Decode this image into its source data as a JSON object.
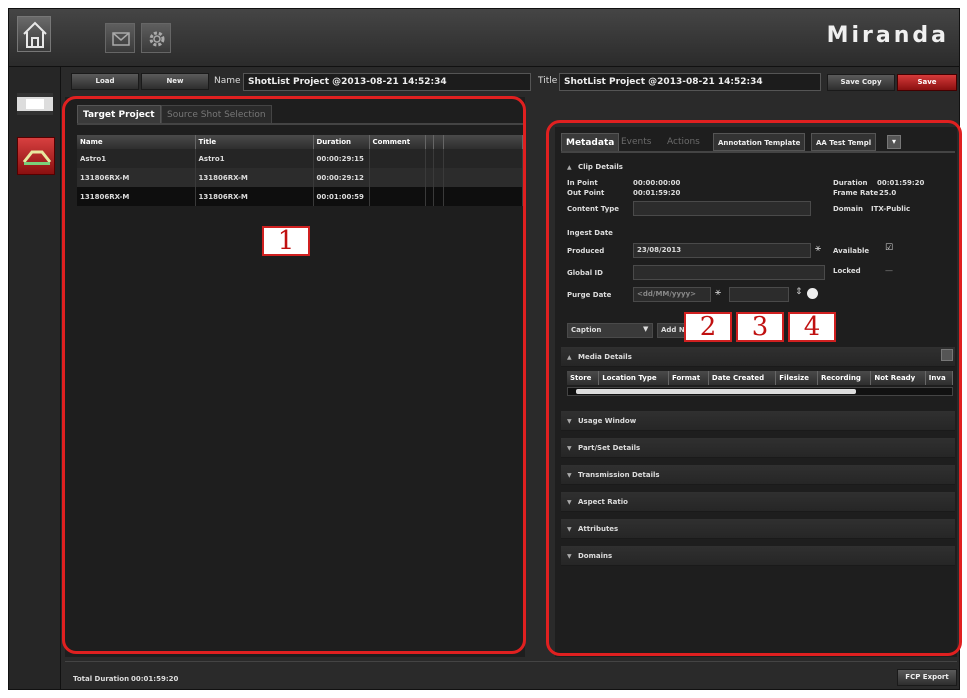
{
  "brand": {
    "logo_text": "Miranda"
  },
  "toolbar": {
    "home_icon": "home-icon",
    "mail_icon": "mail-icon",
    "settings_icon": "gear-icon"
  },
  "header": {
    "load_label": "Load",
    "new_label": "New",
    "name_label": "Name",
    "name_value": "ShotList Project @2013-08-21 14:52:34",
    "title_label": "Title",
    "title_value": "ShotList Project @2013-08-21 14:52:34",
    "save_copy_label": "Save Copy",
    "save_label": "Save"
  },
  "left_panel": {
    "tabs": [
      {
        "label": "Target Project"
      },
      {
        "label": "Source Shot Selection"
      }
    ],
    "columns": [
      "Name",
      "Title",
      "Duration",
      "Comment"
    ],
    "rows": [
      {
        "name": "Astro1",
        "title": "Astro1",
        "duration": "00:00:29:15",
        "comment": ""
      },
      {
        "name": "131806RX-M",
        "title": "131806RX-M",
        "duration": "00:00:29:12",
        "comment": ""
      },
      {
        "name": "131806RX-M",
        "title": "131806RX-M",
        "duration": "00:01:00:59",
        "comment": ""
      }
    ]
  },
  "right_panel": {
    "tabs": [
      {
        "label": "Metadata"
      },
      {
        "label": "Events"
      },
      {
        "label": "Actions"
      },
      {
        "label": "Annotation Template"
      },
      {
        "label": "AA Test Templ"
      }
    ],
    "clip_details": {
      "title": "Clip Details",
      "in_point_label": "In Point",
      "in_point_value": "00:00:00:00",
      "out_point_label": "Out Point",
      "out_point_value": "00:01:59:20",
      "duration_label": "Duration",
      "duration_value": "00:01:59:20",
      "frame_rate_label": "Frame Rate",
      "frame_rate_value": "25.0",
      "content_type_label": "Content Type",
      "domain_label": "Domain",
      "domain_value": "ITX-Public",
      "ingest_date_label": "Ingest Date",
      "produced_label": "Produced",
      "produced_value": "23/08/2013",
      "available_label": "Available",
      "global_id_label": "Global ID",
      "locked_label": "Locked",
      "purge_date_label": "Purge Date",
      "purge_date_placeholder": "<dd/MM/yyyy>"
    },
    "caption": {
      "select_value": "Caption",
      "add_label": "Add N"
    },
    "media_details": {
      "title": "Media Details",
      "columns": [
        "Store",
        "Location Type",
        "Format",
        "Date Created",
        "Filesize",
        "Recording",
        "Not Ready",
        "Inva"
      ]
    },
    "sections": [
      {
        "label": "Usage Window"
      },
      {
        "label": "Part/Set Details"
      },
      {
        "label": "Transmission Details"
      },
      {
        "label": "Aspect Ratio"
      },
      {
        "label": "Attributes"
      },
      {
        "label": "Domains"
      }
    ]
  },
  "footer": {
    "total_duration_label": "Total Duration",
    "total_duration_value": "00:01:59:20",
    "fcp_export_label": "FCP Export"
  },
  "callouts": [
    "1",
    "2",
    "3",
    "4"
  ],
  "colors": {
    "highlight": "#e02020",
    "save": "#c02020"
  }
}
